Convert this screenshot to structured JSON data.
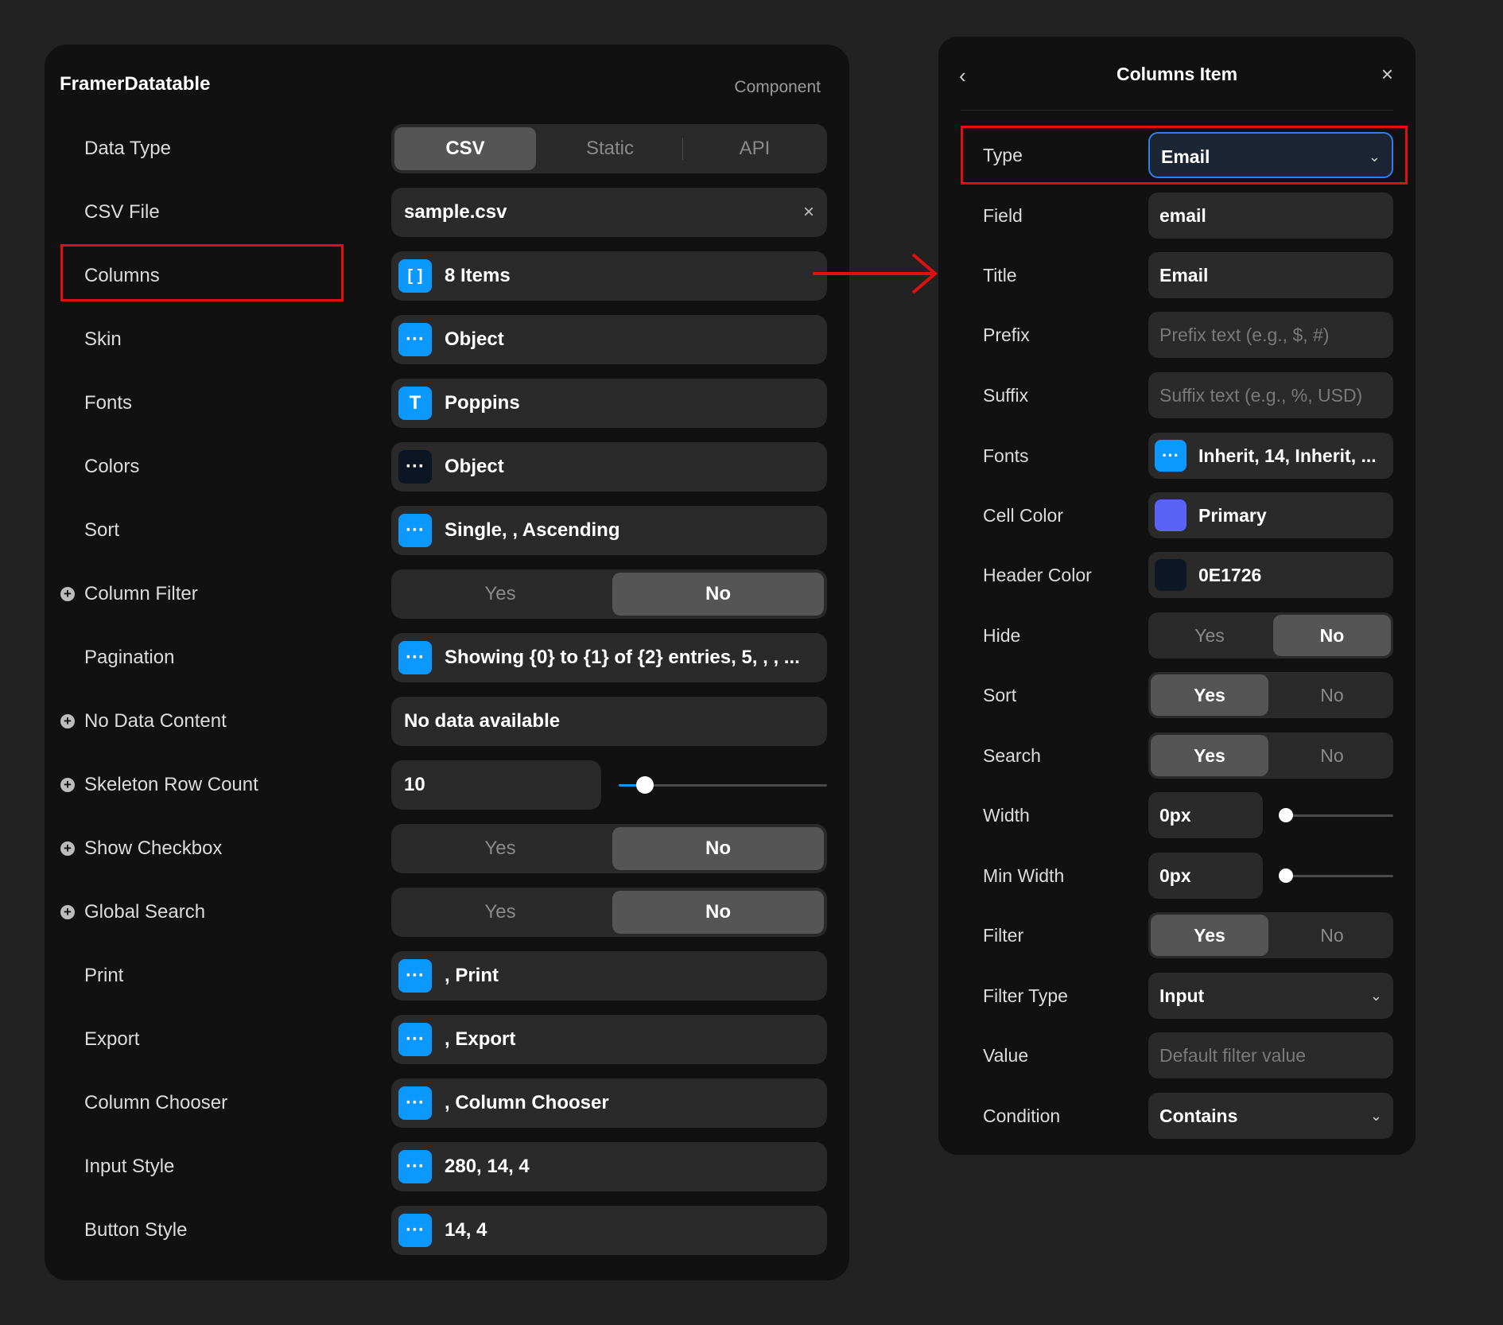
{
  "left": {
    "title": "FramerDatatable",
    "subtitle": "Component",
    "data_type": {
      "label": "Data Type",
      "options": [
        "CSV",
        "Static",
        "API"
      ],
      "selected": "CSV"
    },
    "csv_file": {
      "label": "CSV File",
      "value": "sample.csv",
      "clear": "×"
    },
    "columns": {
      "label": "Columns",
      "chip": "[ ]",
      "value": "8 Items"
    },
    "skin": {
      "label": "Skin",
      "chip": "···",
      "value": "Object"
    },
    "fonts": {
      "label": "Fonts",
      "chip": "T",
      "value": "Poppins"
    },
    "colors": {
      "label": "Colors",
      "chip": "···",
      "value": "Object"
    },
    "sort": {
      "label": "Sort",
      "chip": "···",
      "value": "Single, , Ascending"
    },
    "column_filter": {
      "label": "Column Filter",
      "yes": "Yes",
      "no": "No",
      "selected": "No"
    },
    "pagination": {
      "label": "Pagination",
      "chip": "···",
      "value": "Showing {0} to {1} of {2} entries, 5, , , ..."
    },
    "no_data_content": {
      "label": "No Data Content",
      "value": "No data available"
    },
    "skeleton_row_count": {
      "label": "Skeleton Row Count",
      "value": "10"
    },
    "show_checkbox": {
      "label": "Show Checkbox",
      "yes": "Yes",
      "no": "No",
      "selected": "No"
    },
    "global_search": {
      "label": "Global Search",
      "yes": "Yes",
      "no": "No",
      "selected": "No"
    },
    "print": {
      "label": "Print",
      "chip": "···",
      "value": ", Print"
    },
    "export": {
      "label": "Export",
      "chip": "···",
      "value": ", Export"
    },
    "column_chooser": {
      "label": "Column Chooser",
      "chip": "···",
      "value": ", Column Chooser"
    },
    "input_style": {
      "label": "Input Style",
      "chip": "···",
      "value": "280, 14, 4"
    },
    "button_style": {
      "label": "Button Style",
      "chip": "···",
      "value": "14, 4"
    },
    "plus_icon": "+"
  },
  "right": {
    "title": "Columns Item",
    "back_icon": "‹",
    "close_icon": "×",
    "chevron": "⌄",
    "type": {
      "label": "Type",
      "value": "Email"
    },
    "field": {
      "label": "Field",
      "value": "email"
    },
    "title_field": {
      "label": "Title",
      "value": "Email"
    },
    "prefix": {
      "label": "Prefix",
      "placeholder": "Prefix text (e.g., $, #)"
    },
    "suffix": {
      "label": "Suffix",
      "placeholder": "Suffix text (e.g., %, USD)"
    },
    "fonts": {
      "label": "Fonts",
      "chip": "···",
      "value": "Inherit, 14, Inherit, ..."
    },
    "cell_color": {
      "label": "Cell Color",
      "value": "Primary",
      "swatch": "#5b63f6"
    },
    "header_color": {
      "label": "Header Color",
      "value": "0E1726",
      "swatch": "#0e1726"
    },
    "hide": {
      "label": "Hide",
      "yes": "Yes",
      "no": "No",
      "selected": "No"
    },
    "sort": {
      "label": "Sort",
      "yes": "Yes",
      "no": "No",
      "selected": "Yes"
    },
    "search": {
      "label": "Search",
      "yes": "Yes",
      "no": "No",
      "selected": "Yes"
    },
    "width": {
      "label": "Width",
      "value": "0px"
    },
    "min_width": {
      "label": "Min Width",
      "value": "0px"
    },
    "filter": {
      "label": "Filter",
      "yes": "Yes",
      "no": "No",
      "selected": "Yes"
    },
    "filter_type": {
      "label": "Filter Type",
      "value": "Input"
    },
    "value": {
      "label": "Value",
      "placeholder": "Default filter value"
    },
    "condition": {
      "label": "Condition",
      "value": "Contains"
    }
  },
  "colors": {
    "accent": "#0b99ff",
    "highlight": "#e01010",
    "panel": "#111111",
    "control": "#2a2a2a"
  }
}
